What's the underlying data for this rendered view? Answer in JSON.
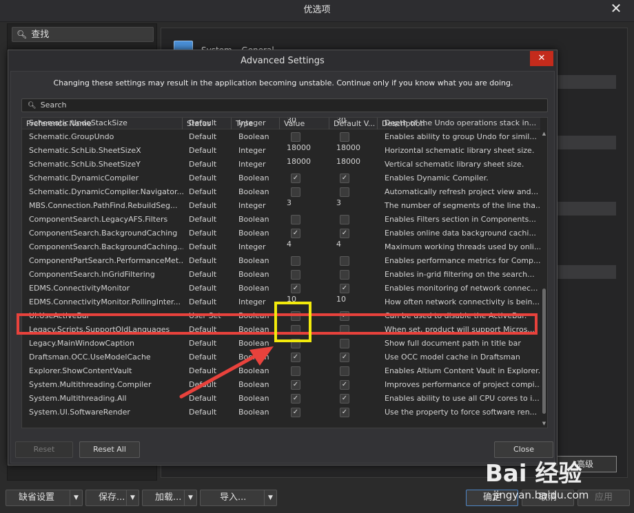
{
  "outer": {
    "title": "优选项",
    "close_glyph": "✕",
    "search_placeholder": "查找",
    "general_title": "System – General",
    "advanced_button": "高级"
  },
  "bottom": {
    "defaults": "缺省设置",
    "save": "保存...",
    "load": "加载...",
    "import": "导入...",
    "ok": "确定",
    "cancel": "取消",
    "apply": "应用"
  },
  "dialog": {
    "title": "Advanced Settings",
    "close_glyph": "✕",
    "warning": "Changing these settings may result in the application becoming unstable. Continue only if you know what you are doing.",
    "search_placeholder": "Search",
    "reset": "Reset",
    "reset_all": "Reset All",
    "close": "Close"
  },
  "grid": {
    "headers": [
      "Preference Name",
      "Status",
      "Type",
      "Value",
      "Default V...",
      "Description"
    ],
    "rows": [
      {
        "name": "Schematic.UndoStackSize",
        "status": "Default",
        "type": "Integer",
        "value": "30",
        "default": "30",
        "desc": "Depth of the Undo operations stack in..."
      },
      {
        "name": "Schematic.GroupUndo",
        "status": "Default",
        "type": "Boolean",
        "value": false,
        "default": false,
        "desc": "Enables ability to group Undo for simil..."
      },
      {
        "name": "Schematic.SchLib.SheetSizeX",
        "status": "Default",
        "type": "Integer",
        "value": "18000",
        "default": "18000",
        "desc": "Horizontal schematic library sheet size."
      },
      {
        "name": "Schematic.SchLib.SheetSizeY",
        "status": "Default",
        "type": "Integer",
        "value": "18000",
        "default": "18000",
        "desc": "Vertical schematic library sheet size."
      },
      {
        "name": "Schematic.DynamicCompiler",
        "status": "Default",
        "type": "Boolean",
        "value": true,
        "default": true,
        "desc": "Enables Dynamic Compiler."
      },
      {
        "name": "Schematic.DynamicCompiler.Navigator....",
        "status": "Default",
        "type": "Boolean",
        "value": false,
        "default": false,
        "desc": "Automatically refresh project view and..."
      },
      {
        "name": "MBS.Connection.PathFind.RebuildSeg...",
        "status": "Default",
        "type": "Integer",
        "value": "3",
        "default": "3",
        "desc": "The number of segments of the line tha..."
      },
      {
        "name": "ComponentSearch.LegacyAFS.Filters",
        "status": "Default",
        "type": "Boolean",
        "value": false,
        "default": false,
        "desc": "Enables Filters section in Components..."
      },
      {
        "name": "ComponentSearch.BackgroundCaching",
        "status": "Default",
        "type": "Boolean",
        "value": true,
        "default": true,
        "desc": "Enables online data background cachi..."
      },
      {
        "name": "ComponentSearch.BackgroundCaching....",
        "status": "Default",
        "type": "Integer",
        "value": "4",
        "default": "4",
        "desc": "Maximum working threads used by onli..."
      },
      {
        "name": "ComponentPartSearch.PerformanceMet...",
        "status": "Default",
        "type": "Boolean",
        "value": false,
        "default": false,
        "desc": "Enables performance metrics for Comp..."
      },
      {
        "name": "ComponentSearch.InGridFiltering",
        "status": "Default",
        "type": "Boolean",
        "value": false,
        "default": false,
        "desc": "Enables in-grid filtering on the search..."
      },
      {
        "name": "EDMS.ConnectivityMonitor",
        "status": "Default",
        "type": "Boolean",
        "value": true,
        "default": true,
        "desc": "Enables monitoring of network connec..."
      },
      {
        "name": "EDMS.ConnectivityMonitor.PollingInter...",
        "status": "Default",
        "type": "Integer",
        "value": "10",
        "default": "10",
        "desc": "How often network connectivity is bein..."
      },
      {
        "name": "UI.UseActiveBar",
        "status": "User Set",
        "type": "Boolean",
        "value": false,
        "default": true,
        "desc": "Can be used to disable the ActiveBar."
      },
      {
        "name": "Legacy.Scripts.SupportOldLanguages",
        "status": "Default",
        "type": "Boolean",
        "value": false,
        "default": false,
        "desc": "When set, product will support Micros..."
      },
      {
        "name": "Legacy.MainWindowCaption",
        "status": "Default",
        "type": "Boolean",
        "value": false,
        "default": false,
        "desc": "Show full document path in title bar"
      },
      {
        "name": "Draftsman.OCC.UseModelCache",
        "status": "Default",
        "type": "Boolean",
        "value": true,
        "default": true,
        "desc": "Use OCC model cache in Draftsman"
      },
      {
        "name": "Explorer.ShowContentVault",
        "status": "Default",
        "type": "Boolean",
        "value": false,
        "default": false,
        "desc": "Enables Altium Content Vault in Explorer."
      },
      {
        "name": "System.Multithreading.Compiler",
        "status": "Default",
        "type": "Boolean",
        "value": true,
        "default": true,
        "desc": "Improves performance of project compi..."
      },
      {
        "name": "System.Multithreading.All",
        "status": "Default",
        "type": "Boolean",
        "value": true,
        "default": true,
        "desc": "Enables ability to use all CPU cores to i..."
      },
      {
        "name": "System.UI.SoftwareRender",
        "status": "Default",
        "type": "Boolean",
        "value": true,
        "default": true,
        "desc": "Use the property to force software ren..."
      }
    ]
  },
  "watermark": {
    "logo": "Bai 经验",
    "url": "jingyan.baidu.com"
  },
  "colors": {
    "highlight_red": "#e8423c",
    "highlight_yellow": "#f2ea0c",
    "close_red": "#c42b1c"
  }
}
